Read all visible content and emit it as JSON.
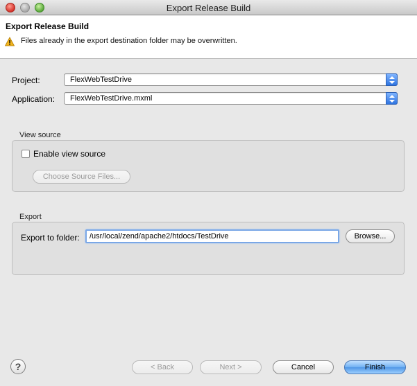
{
  "window": {
    "title": "Export Release Build"
  },
  "header": {
    "title": "Export Release Build",
    "message": "Files already in the export destination folder may be overwritten."
  },
  "form": {
    "project_label": "Project:",
    "project_value": "FlexWebTestDrive",
    "application_label": "Application:",
    "application_value": "FlexWebTestDrive.mxml"
  },
  "view_source": {
    "group_label": "View source",
    "enable_label": "Enable view source",
    "enable_checked": false,
    "choose_button": "Choose Source Files..."
  },
  "export": {
    "group_label": "Export",
    "folder_label": "Export to folder:",
    "folder_value": "/usr/local/zend/apache2/htdocs/TestDrive",
    "browse_button": "Browse..."
  },
  "footer": {
    "help": "?",
    "back_button": "< Back",
    "next_button": "Next >",
    "cancel_button": "Cancel",
    "finish_button": "Finish"
  },
  "colors": {
    "accent": "#4f96e6",
    "warning": "#f2b51e"
  },
  "icons": {
    "warning": "warning-icon",
    "help": "help-icon"
  }
}
